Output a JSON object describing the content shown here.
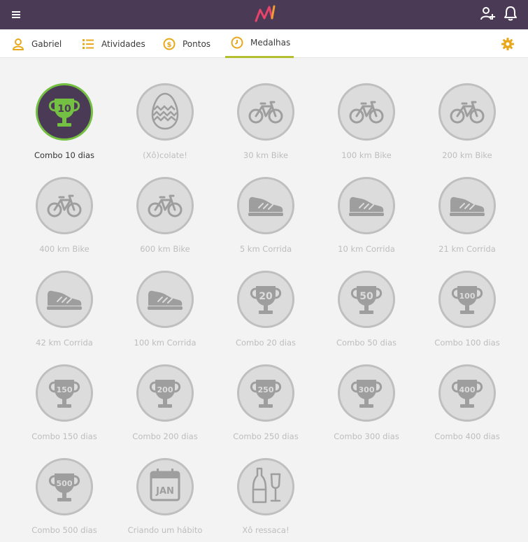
{
  "header": {
    "menu_icon": "menu-icon",
    "logo": "app-logo",
    "add_user_icon": "add-user-icon",
    "bell_icon": "bell-icon",
    "bg_color": "#4b3a55"
  },
  "tabs": [
    {
      "label": "Gabriel",
      "icon": "user-icon",
      "active": false
    },
    {
      "label": "Atividades",
      "icon": "list-icon",
      "active": false
    },
    {
      "label": "Pontos",
      "icon": "coin-icon",
      "active": false
    },
    {
      "label": "Medalhas",
      "icon": "medal-icon",
      "active": true
    }
  ],
  "settings_icon": "gear-icon",
  "colors": {
    "accent": "#e8a81b",
    "active_underline": "#b3bf2f",
    "earned_ring": "#74c043",
    "earned_bg": "#4b3a55",
    "locked_bg": "#dcdcdc",
    "locked_icon": "#9e9e9e"
  },
  "medals": [
    {
      "label": "Combo 10 dias",
      "icon": "trophy",
      "number": "10",
      "earned": true
    },
    {
      "label": "(Xô)colate!",
      "icon": "egg",
      "number": "",
      "earned": false
    },
    {
      "label": "30 km Bike",
      "icon": "bike",
      "number": "",
      "earned": false
    },
    {
      "label": "100 km Bike",
      "icon": "bike",
      "number": "",
      "earned": false
    },
    {
      "label": "200 km Bike",
      "icon": "bike",
      "number": "",
      "earned": false
    },
    {
      "label": "400 km Bike",
      "icon": "bike",
      "number": "",
      "earned": false
    },
    {
      "label": "600 km Bike",
      "icon": "bike",
      "number": "",
      "earned": false
    },
    {
      "label": "5 km Corrida",
      "icon": "shoe",
      "number": "",
      "earned": false
    },
    {
      "label": "10 km Corrida",
      "icon": "shoe",
      "number": "",
      "earned": false
    },
    {
      "label": "21 km Corrida",
      "icon": "shoe",
      "number": "",
      "earned": false
    },
    {
      "label": "42 km Corrida",
      "icon": "shoe",
      "number": "",
      "earned": false
    },
    {
      "label": "100 km Corrida",
      "icon": "shoe",
      "number": "",
      "earned": false
    },
    {
      "label": "Combo 20 dias",
      "icon": "trophy",
      "number": "20",
      "earned": false
    },
    {
      "label": "Combo 50 dias",
      "icon": "trophy",
      "number": "50",
      "earned": false
    },
    {
      "label": "Combo 100 dias",
      "icon": "trophy",
      "number": "100",
      "earned": false
    },
    {
      "label": "Combo 150 dias",
      "icon": "trophy",
      "number": "150",
      "earned": false
    },
    {
      "label": "Combo 200 dias",
      "icon": "trophy",
      "number": "200",
      "earned": false
    },
    {
      "label": "Combo 250 dias",
      "icon": "trophy",
      "number": "250",
      "earned": false
    },
    {
      "label": "Combo 300 dias",
      "icon": "trophy",
      "number": "300",
      "earned": false
    },
    {
      "label": "Combo 400 dias",
      "icon": "trophy",
      "number": "400",
      "earned": false
    },
    {
      "label": "Combo 500 dias",
      "icon": "trophy",
      "number": "500",
      "earned": false
    },
    {
      "label": "Criando um hábito",
      "icon": "calendar",
      "number": "JAN",
      "earned": false
    },
    {
      "label": "Xô ressaca!",
      "icon": "champagne",
      "number": "",
      "earned": false
    }
  ]
}
